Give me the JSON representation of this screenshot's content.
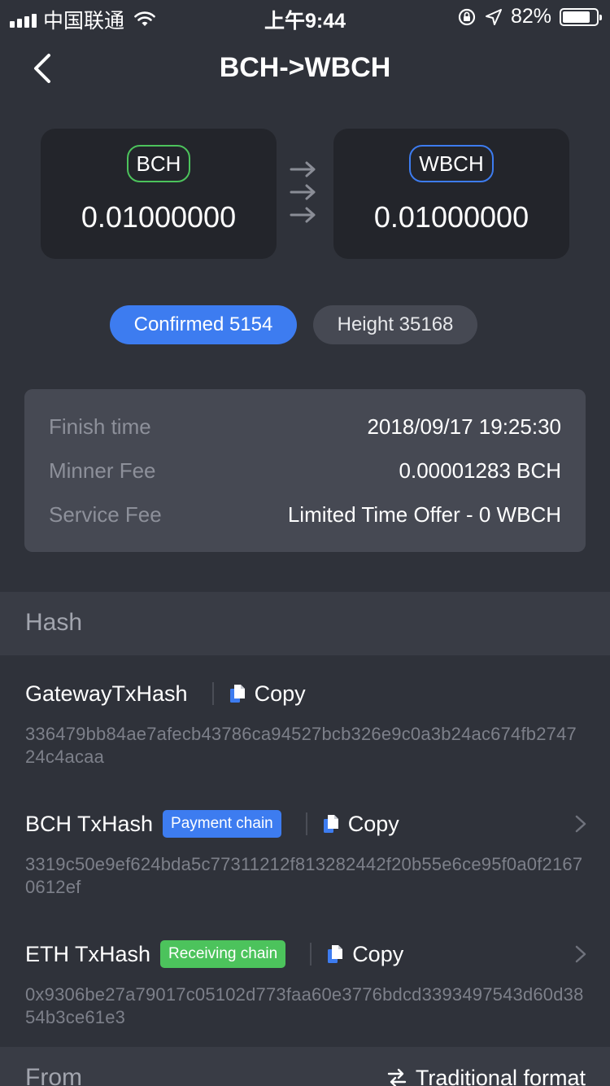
{
  "status_bar": {
    "carrier": "中国联通",
    "time": "上午9:44",
    "battery": "82%",
    "battery_level": 0.82
  },
  "nav": {
    "title": "BCH->WBCH"
  },
  "swap": {
    "from": {
      "token": "BCH",
      "amount": "0.01000000"
    },
    "to": {
      "token": "WBCH",
      "amount": "0.01000000"
    }
  },
  "chips": {
    "confirmed": "Confirmed 5154",
    "height": "Height 35168"
  },
  "info": [
    {
      "label": "Finish time",
      "value": "2018/09/17 19:25:30"
    },
    {
      "label": "Minner Fee",
      "value": "0.00001283 BCH"
    },
    {
      "label": "Service Fee",
      "value": "Limited Time Offer - 0 WBCH"
    }
  ],
  "hash_section": {
    "title": "Hash",
    "items": [
      {
        "title": "GatewayTxHash",
        "badge": "",
        "copy": "Copy",
        "value": "336479bb84ae7afecb43786ca94527bcb326e9c0a3b24ac674fb274724c4acaa"
      },
      {
        "title": "BCH TxHash",
        "badge": "Payment chain",
        "copy": "Copy",
        "value": "3319c50e9ef624bda5c77311212f813282442f20b55e6ce95f0a0f21670612ef"
      },
      {
        "title": "ETH TxHash",
        "badge": "Receiving chain",
        "copy": "Copy",
        "value": "0x9306be27a79017c05102d773faa60e3776bdcd3393497543d60d3854b3ce61e3"
      }
    ]
  },
  "from_section": {
    "title": "From",
    "format_toggle": "Traditional format"
  },
  "colors": {
    "background": "#2f323a",
    "card": "#23252b",
    "accent_blue": "#3d7cf0",
    "accent_green": "#4cc35c",
    "panel": "#464953"
  }
}
